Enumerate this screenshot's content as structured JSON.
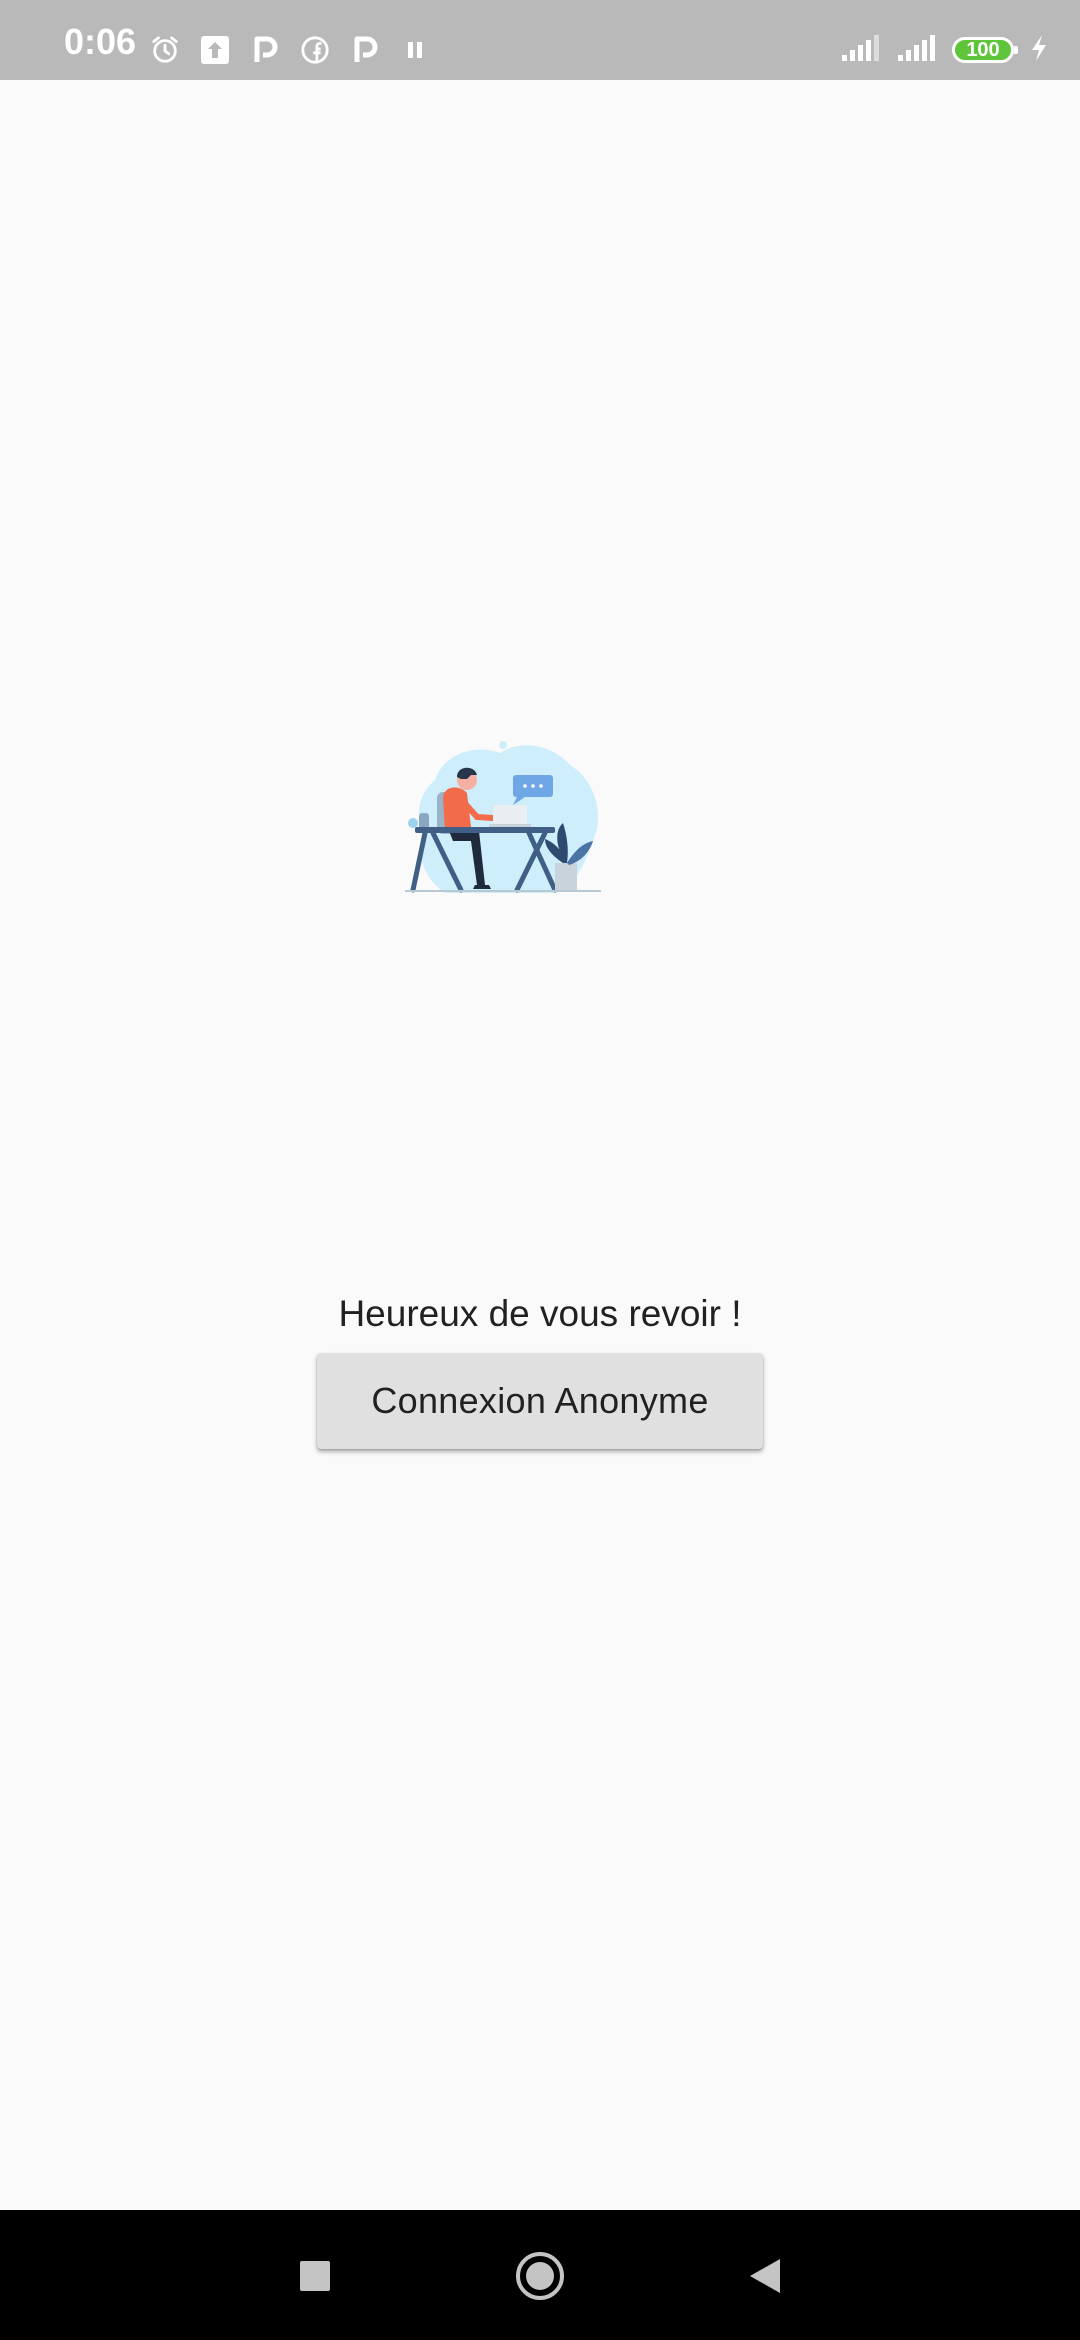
{
  "status_bar": {
    "time": "0:06",
    "battery_level": "100",
    "background_color": "#b9b9b9",
    "battery_color": "#5ec53b",
    "left_icons": [
      "alarm-icon",
      "upload-icon",
      "parking-icon",
      "facebook-icon",
      "parking-icon",
      "pause-icon"
    ],
    "right_icons": [
      "signal-icon",
      "signal-icon",
      "battery-icon",
      "charging-icon"
    ]
  },
  "main": {
    "illustration": "person-working-at-desk-illustration",
    "welcome_text": "Heureux de vous revoir !",
    "login_button_label": "Connexion Anonyme",
    "button_color": "#e0e0e0"
  },
  "nav_bar": {
    "buttons": [
      "recents-square-icon",
      "home-circle-icon",
      "back-triangle-icon"
    ]
  }
}
